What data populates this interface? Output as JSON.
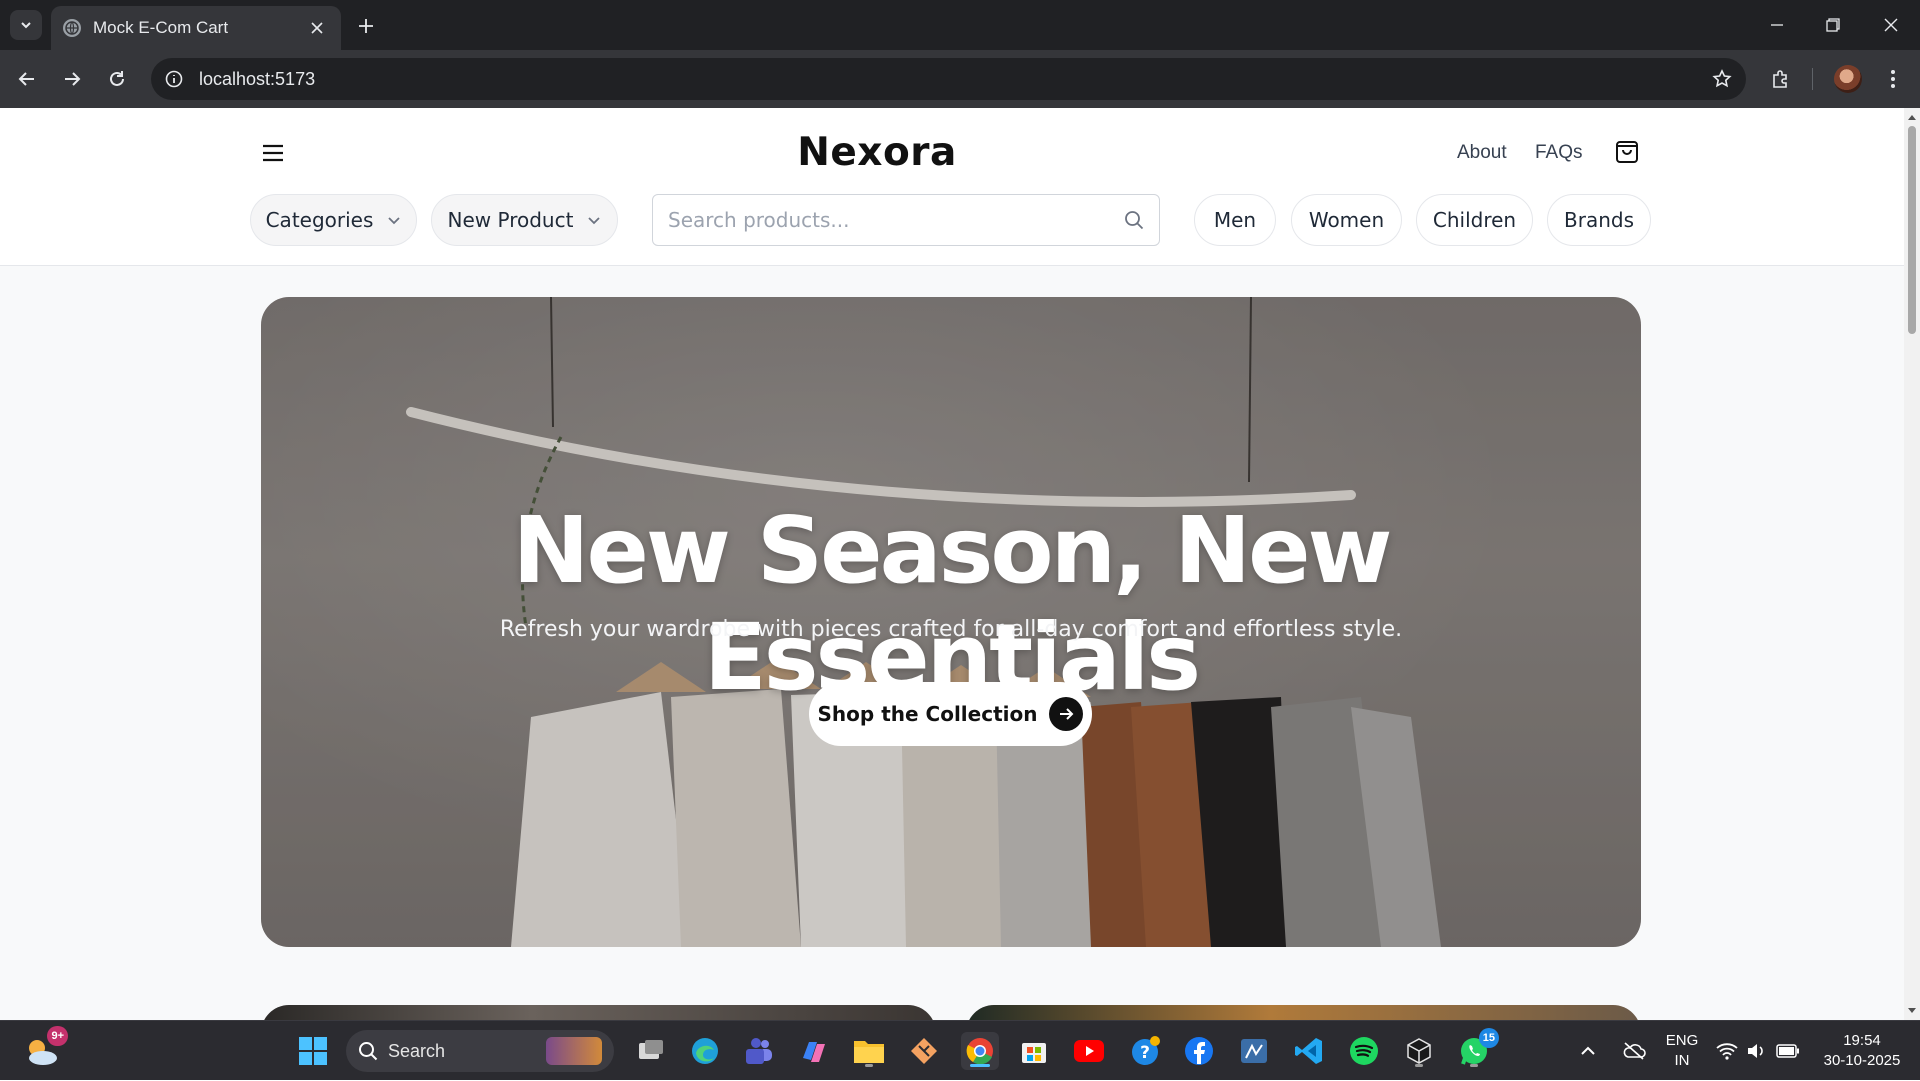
{
  "browser": {
    "tab_title": "Mock E-Com Cart",
    "url": "localhost:5173"
  },
  "site": {
    "brand": "Nexora",
    "top_links": [
      "About",
      "FAQs"
    ],
    "dropdowns": [
      "Categories",
      "New Product"
    ],
    "search_placeholder": "Search products...",
    "category_pills": [
      "Men",
      "Women",
      "Children",
      "Brands"
    ]
  },
  "hero": {
    "heading": "New Season, New Essentials",
    "subheading": "Refresh your wardrobe with pieces crafted for all-day comfort and effortless style.",
    "cta_label": "Shop the Collection"
  },
  "taskbar": {
    "search_label": "Search",
    "weather_badge": "9+",
    "whatsapp_badge": "15",
    "lang_line1": "ENG",
    "lang_line2": "IN",
    "time": "19:54",
    "date": "30-10-2025"
  },
  "colors": {
    "chrome_dark": "#202124",
    "chrome_toolbar": "#35363a",
    "cta_icon": "#111111",
    "taskbar": "#2b2b30",
    "active_indicator": "#4cc2ff"
  },
  "icons": [
    "tab-search-icon",
    "globe-icon",
    "close-icon",
    "plus-icon",
    "minimize-icon",
    "restore-icon",
    "back-arrow-icon",
    "forward-arrow-icon",
    "reload-icon",
    "info-icon",
    "star-icon",
    "extensions-icon",
    "kebab-menu-icon",
    "hamburger-menu-icon",
    "shopping-bag-icon",
    "chevron-down-icon",
    "search-icon",
    "arrow-right-icon"
  ]
}
